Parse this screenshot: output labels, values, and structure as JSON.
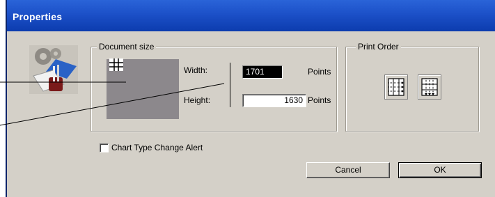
{
  "window": {
    "title": "Properties"
  },
  "document_size": {
    "group_label": "Document size",
    "width_label": "Width:",
    "height_label": "Height:",
    "width_value": "1701",
    "height_value": "1630",
    "unit_label_width": "Points",
    "unit_label_height": "Points"
  },
  "print_order": {
    "group_label": "Print Order",
    "options": [
      {
        "icon": "across-then-down-icon",
        "selected": false
      },
      {
        "icon": "down-then-across-icon",
        "selected": false
      }
    ]
  },
  "options": {
    "chart_type_change_alert_label": "Chart Type Change Alert",
    "chart_type_change_alert_checked": false
  },
  "buttons": {
    "cancel_label": "Cancel",
    "ok_label": "OK"
  },
  "colors": {
    "titlebar": "#1c50c8",
    "dialog_bg": "#d4d0c8",
    "preview_fill": "#8c888c",
    "selected_field_bg": "#000000"
  }
}
